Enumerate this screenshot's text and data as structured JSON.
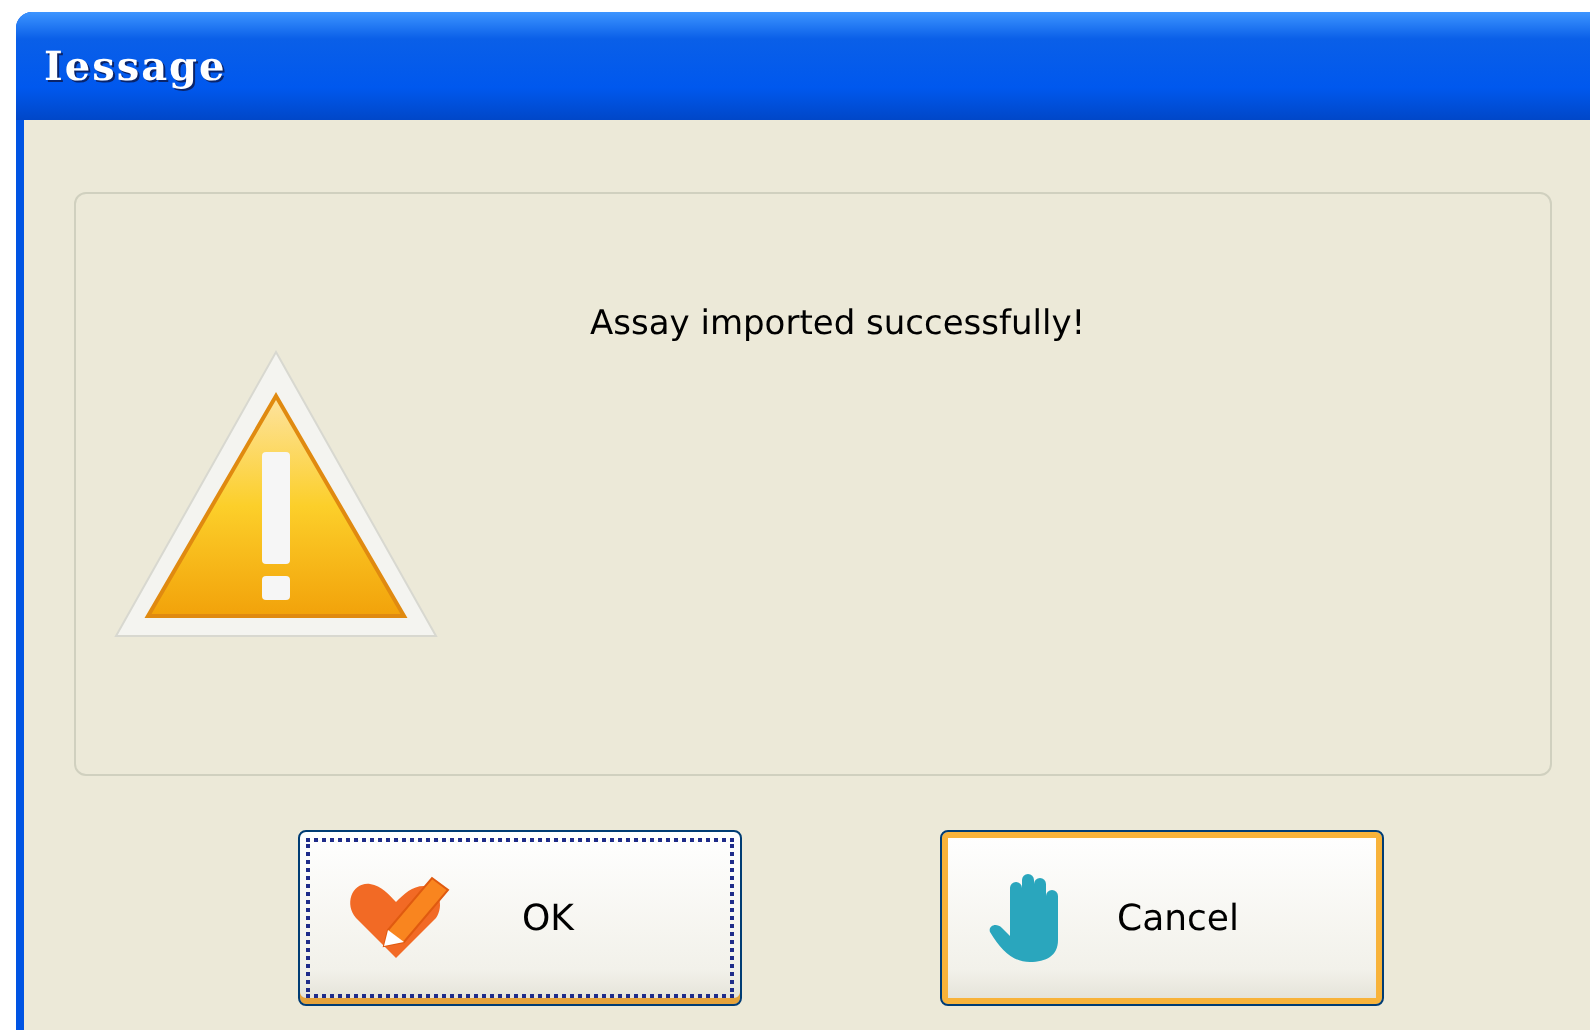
{
  "window": {
    "title": "Iessage"
  },
  "message": "Assay imported successfully!",
  "buttons": [
    {
      "label": "OK",
      "kind": "ok",
      "focused": true,
      "hot": false
    },
    {
      "label": "Cancel",
      "kind": "cancel",
      "focused": false,
      "hot": true
    }
  ]
}
